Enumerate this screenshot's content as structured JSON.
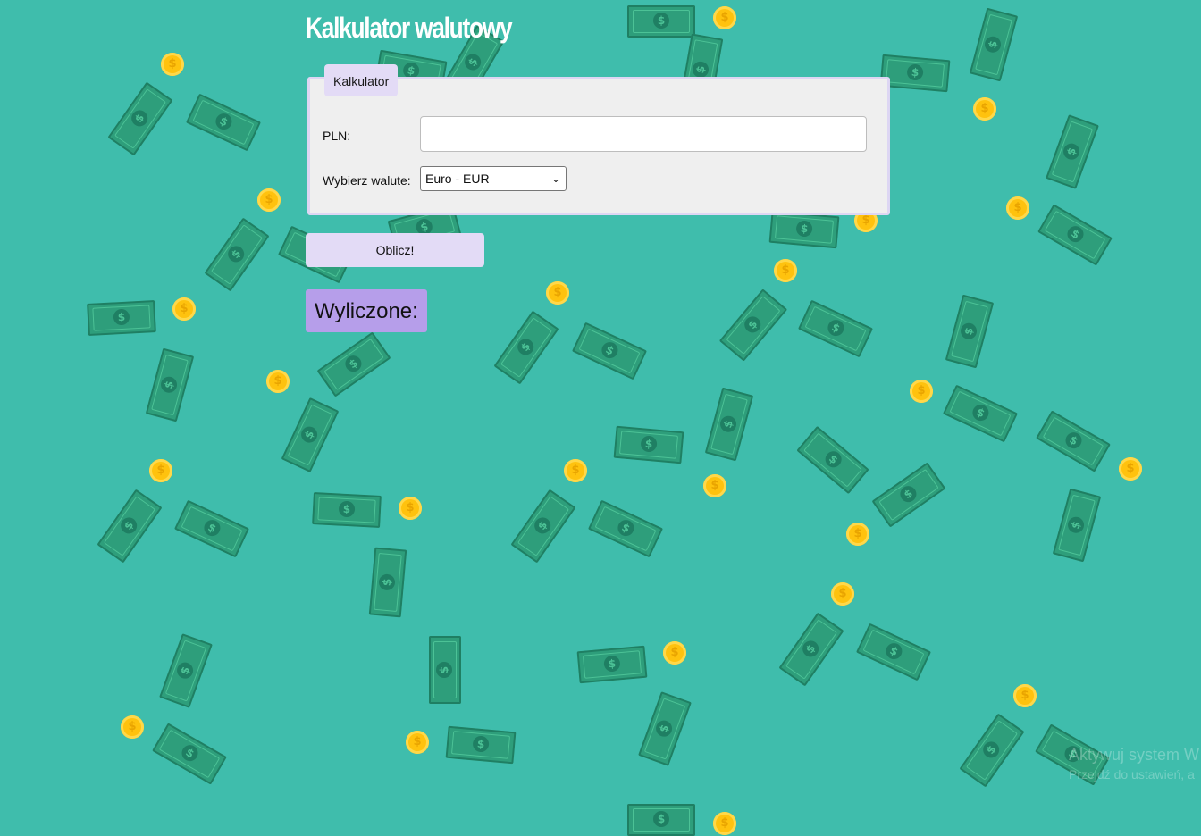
{
  "app": {
    "title": "Kalkulator walutowy",
    "panel_legend": "Kalkulator",
    "pln_label": "PLN:",
    "pln_value": "",
    "pln_placeholder": "",
    "currency_label": "Wybierz walute:",
    "currency_selected": "Euro - EUR",
    "calculate_button": "Oblicz!",
    "result_label": "Wyliczone:"
  },
  "watermark": {
    "line1": "Aktywuj system W",
    "line2": "Przejdź do ustawień, a"
  },
  "colors": {
    "background": "#3fbdac",
    "bill": "#2e9e7b",
    "coin": "#ffc20e",
    "panel": "#efefef",
    "accent_light": "#e3dbf6",
    "result_bg": "#b69eea"
  },
  "background_icons": {
    "bill": "dollar-bill-icon",
    "coin": "dollar-coin-icon"
  }
}
